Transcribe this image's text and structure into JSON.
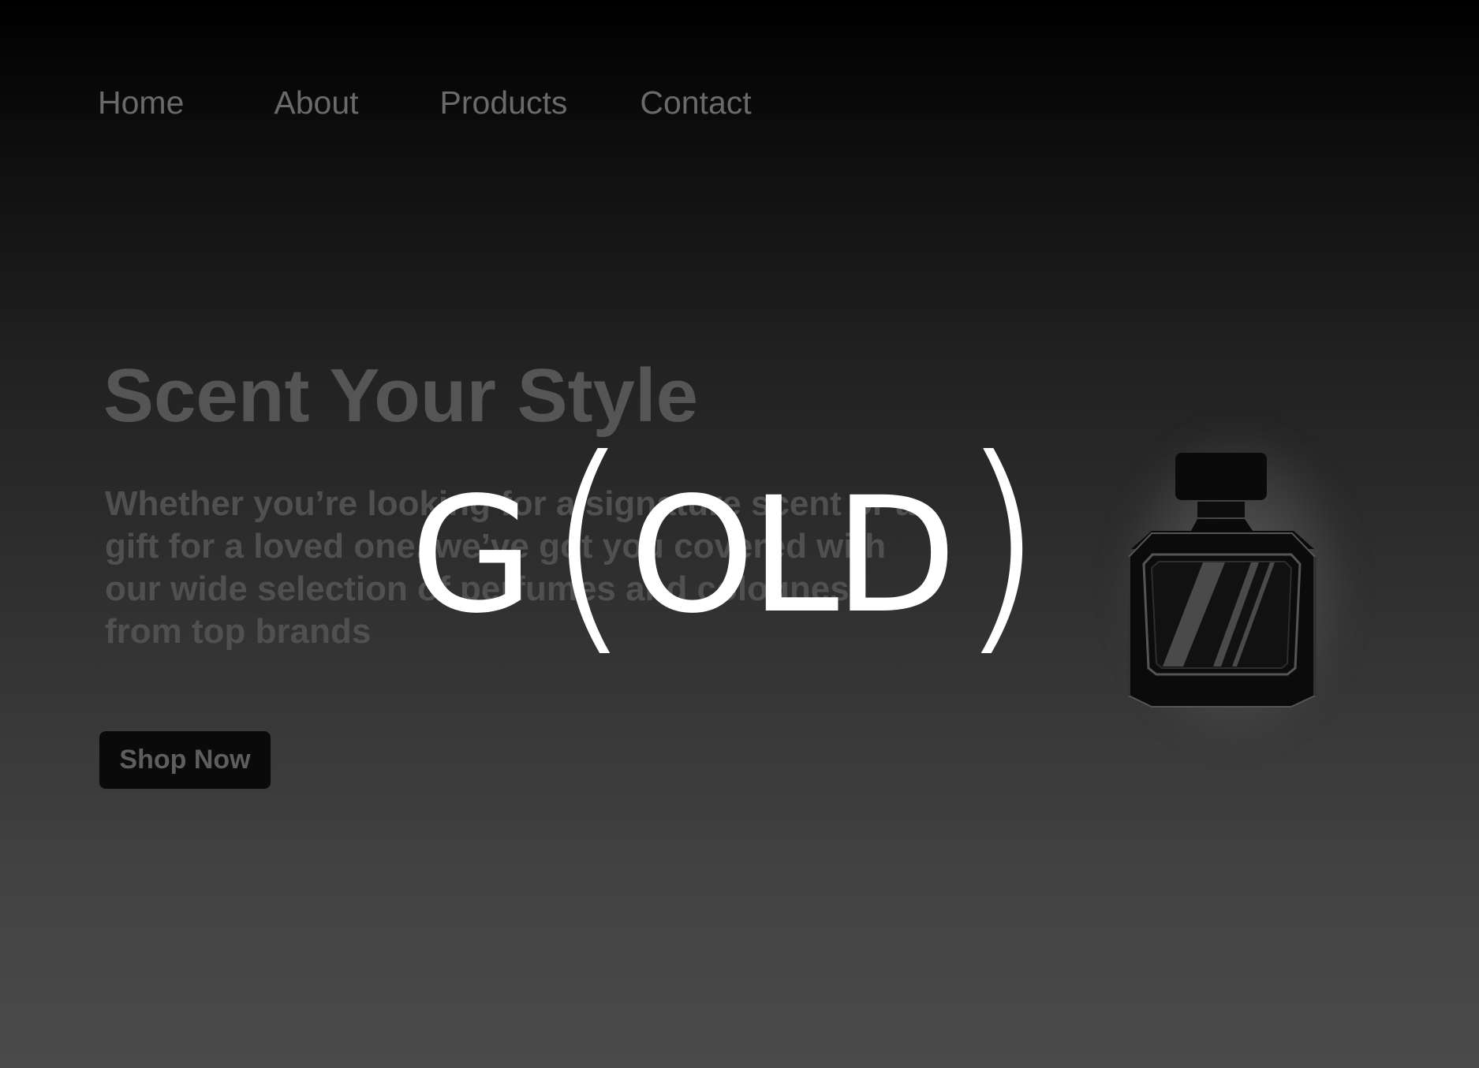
{
  "nav": {
    "items": [
      {
        "label": "Home"
      },
      {
        "label": "About"
      },
      {
        "label": "Products"
      },
      {
        "label": "Contact"
      }
    ]
  },
  "hero": {
    "title": "Scent Your Style",
    "description": "Whether you’re looking for a signature scent or a gift for a loved one, we’ve got you covered with our wide selection of perfumes and colognes from top brands",
    "cta_label": "Shop Now"
  },
  "logo": {
    "text_g": "G",
    "text_open": "(",
    "text_old": "OLD",
    "text_close": ")"
  },
  "icons": {
    "bottle": "perfume-bottle-icon"
  },
  "colors": {
    "background_top": "#000000",
    "background_bottom": "#4a4a4a",
    "nav_text": "#6a6a6a",
    "logo": "#ffffff",
    "button_bg": "#0a0a0a"
  }
}
